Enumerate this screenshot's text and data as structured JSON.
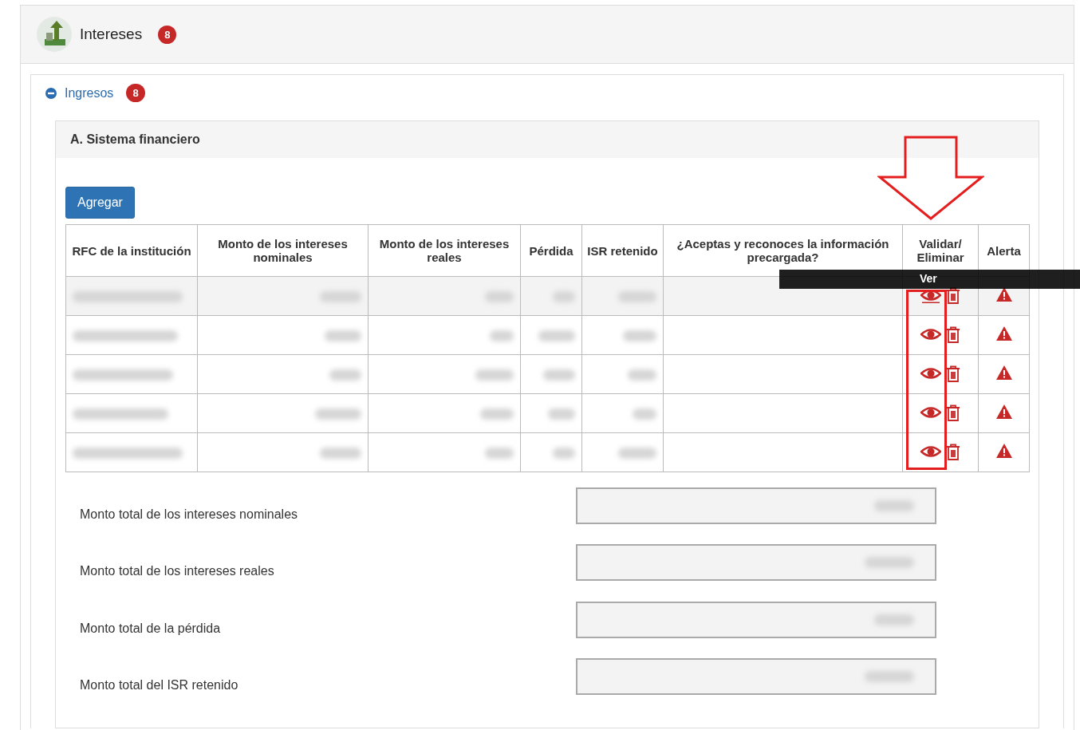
{
  "panel": {
    "title": "Intereses",
    "badge": "8"
  },
  "section": {
    "title": "Ingresos",
    "badge": "8",
    "expanded": true
  },
  "subsection": {
    "title": "A. Sistema financiero"
  },
  "add_button": "Agregar",
  "table": {
    "columns": [
      "RFC de la institución",
      "Monto de los intereses nominales",
      "Monto de los intereses reales",
      "Pérdida",
      "ISR retenido",
      "¿Aceptas y reconoces la información precargada?",
      "Validar/ Eliminar",
      "Alerta"
    ],
    "rows": [
      {
        "selected": true
      },
      {
        "selected": false
      },
      {
        "selected": false
      },
      {
        "selected": false
      },
      {
        "selected": false
      }
    ]
  },
  "tooltip": "Ver",
  "totals": [
    {
      "label": "Monto total de los intereses nominales"
    },
    {
      "label": "Monto total de los intereses reales"
    },
    {
      "label": "Monto total de la pérdida"
    },
    {
      "label": "Monto total del ISR retenido"
    }
  ]
}
